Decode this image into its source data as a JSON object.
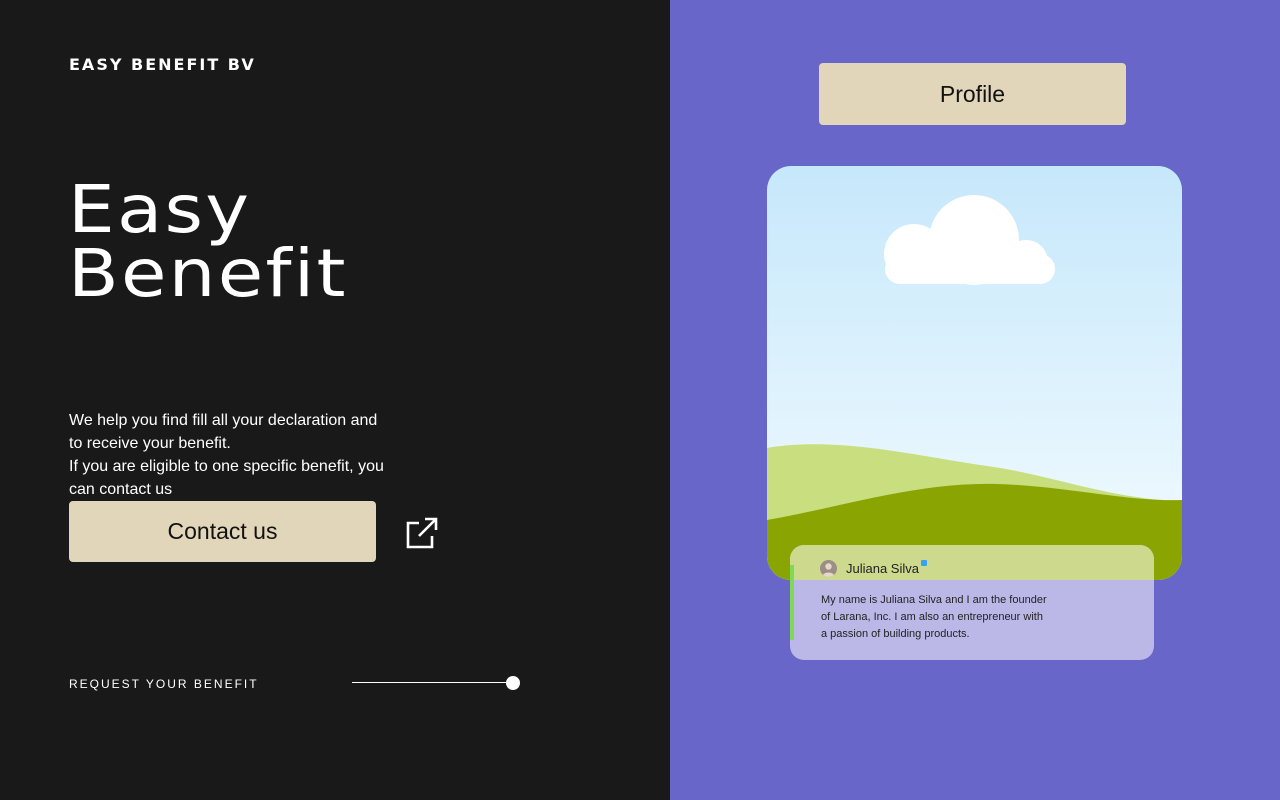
{
  "brand": {
    "name": "EASY BENEFIT BV"
  },
  "hero": {
    "title_line1": "Easy",
    "title_line2": "Benefit"
  },
  "description": {
    "line1": "We help you find fill all your declaration and",
    "line2": "to receive your benefit.",
    "line3": "If you are eligible to one specific benefit, you",
    "line4": "can contact us"
  },
  "contact": {
    "button_label": "Contact us",
    "link_icon": "external-link-icon"
  },
  "request": {
    "label": "REQUEST YOUR BENEFIT"
  },
  "profile": {
    "button_label": "Profile"
  },
  "card": {
    "name": "Juliana Silva",
    "bio_line1": "My name is Juliana Silva and I am the founder",
    "bio_line2": "of Larana, Inc. I am also an entrepreneur with",
    "bio_line3": "a passion of building products."
  },
  "colors": {
    "left_background": "#191919",
    "right_background": "#6966ca",
    "button_background": "#e1d6b9",
    "card_background": "#bbb8e8",
    "card_header": "#cdd98d",
    "card_accent": "#7ed957"
  }
}
